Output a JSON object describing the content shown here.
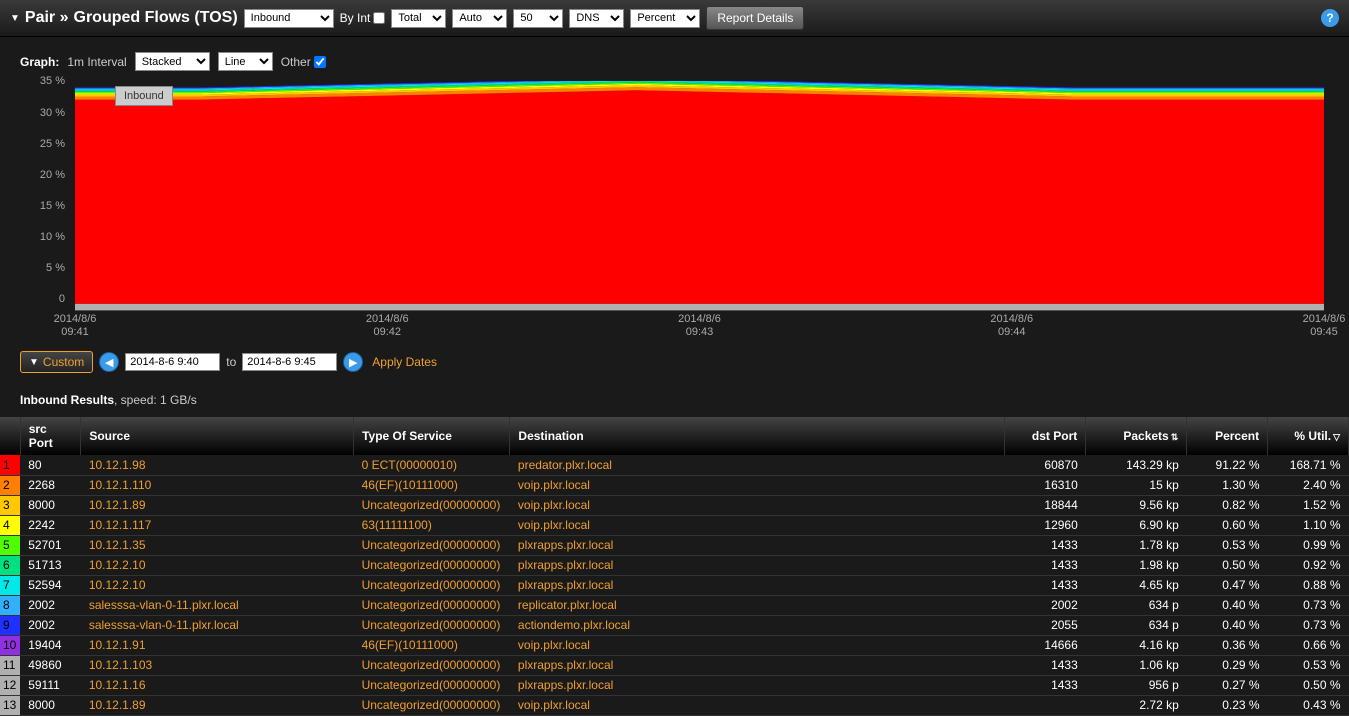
{
  "header": {
    "title_prefix": "Pair »",
    "title_main": "Grouped Flows (TOS)",
    "direction": "Inbound",
    "byint_label": "By Int",
    "total": "Total",
    "auto": "Auto",
    "limit": "50",
    "dns": "DNS",
    "percent": "Percent",
    "report_details": "Report Details"
  },
  "graph": {
    "label": "Graph:",
    "interval": "1m Interval",
    "stacked": "Stacked",
    "line": "Line",
    "other_label": "Other",
    "hover_label": "Inbound"
  },
  "date_controls": {
    "custom": "Custom",
    "from": "2014-8-6 9:40",
    "to_label": "to",
    "to": "2014-8-6 9:45",
    "apply": "Apply Dates"
  },
  "results": {
    "label_bold": "Inbound Results",
    "label_rest": ", speed: 1 GB/s"
  },
  "table": {
    "headers": {
      "srcport": "src Port",
      "source": "Source",
      "tos": "Type Of Service",
      "dest": "Destination",
      "dstport": "dst Port",
      "packets": "Packets",
      "percent": "Percent",
      "util": "% Util."
    },
    "rows": [
      {
        "idx": "1",
        "color": "#ff0000",
        "srcport": "80",
        "source": "10.12.1.98",
        "tos": "0 ECT(00000010)",
        "dest": "predator.plxr.local",
        "dstport": "60870",
        "packets": "143.29 kp",
        "percent": "91.22 %",
        "util": "168.71 %"
      },
      {
        "idx": "2",
        "color": "#ff7f00",
        "srcport": "2268",
        "source": "10.12.1.110",
        "tos": "46(EF)(10111000)",
        "dest": "voip.plxr.local",
        "dstport": "16310",
        "packets": "15 kp",
        "percent": "1.30 %",
        "util": "2.40 %"
      },
      {
        "idx": "3",
        "color": "#ffc800",
        "srcport": "8000",
        "source": "10.12.1.89",
        "tos": "Uncategorized(00000000)",
        "dest": "voip.plxr.local",
        "dstport": "18844",
        "packets": "9.56 kp",
        "percent": "0.82 %",
        "util": "1.52 %"
      },
      {
        "idx": "4",
        "color": "#ffff00",
        "srcport": "2242",
        "source": "10.12.1.117",
        "tos": "63(11111100)",
        "dest": "voip.plxr.local",
        "dstport": "12960",
        "packets": "6.90 kp",
        "percent": "0.60 %",
        "util": "1.10 %"
      },
      {
        "idx": "5",
        "color": "#4fff00",
        "srcport": "52701",
        "source": "10.12.1.35",
        "tos": "Uncategorized(00000000)",
        "dest": "plxrapps.plxr.local",
        "dstport": "1433",
        "packets": "1.78 kp",
        "percent": "0.53 %",
        "util": "0.99 %"
      },
      {
        "idx": "6",
        "color": "#00e080",
        "srcport": "51713",
        "source": "10.12.2.10",
        "tos": "Uncategorized(00000000)",
        "dest": "plxrapps.plxr.local",
        "dstport": "1433",
        "packets": "1.98 kp",
        "percent": "0.50 %",
        "util": "0.92 %"
      },
      {
        "idx": "7",
        "color": "#00e8e8",
        "srcport": "52594",
        "source": "10.12.2.10",
        "tos": "Uncategorized(00000000)",
        "dest": "plxrapps.plxr.local",
        "dstport": "1433",
        "packets": "4.65 kp",
        "percent": "0.47 %",
        "util": "0.88 %"
      },
      {
        "idx": "8",
        "color": "#30b0ff",
        "srcport": "2002",
        "source": "salesssa-vlan-0-11.plxr.local",
        "tos": "Uncategorized(00000000)",
        "dest": "replicator.plxr.local",
        "dstport": "2002",
        "packets": "634 p",
        "percent": "0.40 %",
        "util": "0.73 %"
      },
      {
        "idx": "9",
        "color": "#2030ff",
        "srcport": "2002",
        "source": "salesssa-vlan-0-11.plxr.local",
        "tos": "Uncategorized(00000000)",
        "dest": "actiondemo.plxr.local",
        "dstport": "2055",
        "packets": "634 p",
        "percent": "0.40 %",
        "util": "0.73 %"
      },
      {
        "idx": "10",
        "color": "#9030e0",
        "srcport": "19404",
        "source": "10.12.1.91",
        "tos": "46(EF)(10111000)",
        "dest": "voip.plxr.local",
        "dstport": "14666",
        "packets": "4.16 kp",
        "percent": "0.36 %",
        "util": "0.66 %"
      },
      {
        "idx": "11",
        "color": "#b0b0b0",
        "srcport": "49860",
        "source": "10.12.1.103",
        "tos": "Uncategorized(00000000)",
        "dest": "plxrapps.plxr.local",
        "dstport": "1433",
        "packets": "1.06 kp",
        "percent": "0.29 %",
        "util": "0.53 %"
      },
      {
        "idx": "12",
        "color": "#b0b0b0",
        "srcport": "59111",
        "source": "10.12.1.16",
        "tos": "Uncategorized(00000000)",
        "dest": "plxrapps.plxr.local",
        "dstport": "1433",
        "packets": "956 p",
        "percent": "0.27 %",
        "util": "0.50 %"
      },
      {
        "idx": "13",
        "color": "#b0b0b0",
        "srcport": "8000",
        "source": "10.12.1.89",
        "tos": "Uncategorized(00000000)",
        "dest": "voip.plxr.local",
        "dstport": "",
        "packets": "2.72 kp",
        "percent": "0.23 %",
        "util": "0.43 %"
      }
    ]
  },
  "chart_data": {
    "type": "area",
    "title": "",
    "xlabel": "",
    "ylabel": "",
    "ylim": [
      0,
      37
    ],
    "yticks": [
      "0",
      "5 %",
      "10 %",
      "15 %",
      "20 %",
      "25 %",
      "30 %",
      "35 %"
    ],
    "xticks": [
      {
        "pos": 0,
        "label": "2014/8/6\n09:41"
      },
      {
        "pos": 25,
        "label": "2014/8/6\n09:42"
      },
      {
        "pos": 50,
        "label": "2014/8/6\n09:43"
      },
      {
        "pos": 75,
        "label": "2014/8/6\n09:44"
      },
      {
        "pos": 100,
        "label": "2014/8/6\n09:45"
      }
    ],
    "series": [
      {
        "name": "other",
        "color": "#b0b0b0",
        "base_pct": 1.0
      },
      {
        "name": "row1",
        "color": "#ff0000",
        "base_pct": 33.0
      },
      {
        "name": "row2",
        "color": "#ff7f00",
        "base_pct": 0.5
      },
      {
        "name": "row3",
        "color": "#ffc800",
        "base_pct": 0.3
      },
      {
        "name": "row4",
        "color": "#ffff00",
        "base_pct": 0.25
      },
      {
        "name": "row5",
        "color": "#4fff00",
        "base_pct": 0.2
      },
      {
        "name": "row6",
        "color": "#00e080",
        "base_pct": 0.2
      },
      {
        "name": "row7",
        "color": "#00e8e8",
        "base_pct": 0.2
      },
      {
        "name": "row8",
        "color": "#30b0ff",
        "base_pct": 0.15
      },
      {
        "name": "row9",
        "color": "#2030ff",
        "base_pct": 0.15
      }
    ],
    "bulge_center": 45,
    "bulge_extra": 1.5
  }
}
